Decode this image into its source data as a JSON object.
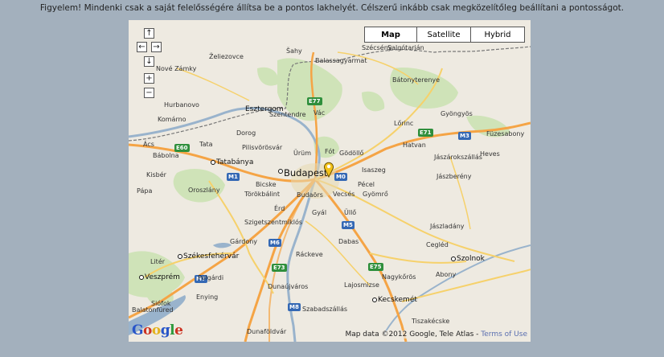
{
  "notice": "Figyelem! Mindenki csak a saját felelősségére állítsa be a pontos lakhelyét. Célszerű inkább csak megközelítőleg beállítani a pontosságot.",
  "map_types": [
    {
      "label": "Map",
      "active": true
    },
    {
      "label": "Satellite",
      "active": false
    },
    {
      "label": "Hybrid",
      "active": false
    }
  ],
  "nav": {
    "pan_up": "↑",
    "pan_left": "←",
    "pan_right": "→",
    "pan_down": "↓",
    "zoom_in": "+",
    "zoom_out": "−"
  },
  "places": {
    "capital": "Budapest",
    "cities": [
      "Tatabánya",
      "Székesfehérvár",
      "Veszprém",
      "Kecskemét",
      "Szolnok",
      "Esztergom"
    ],
    "towns": [
      "Šahy",
      "Balassagyarmat",
      "Szécsény",
      "Salgótarján",
      "Želiezovce",
      "Nové Zámky",
      "Bátonyterenye",
      "Hurbanovo",
      "Komárno",
      "Vác",
      "Dorog",
      "Szentendre",
      "Pilisvörösvár",
      "Ürüm",
      "Fót",
      "Gödöllő",
      "Gyöngyös",
      "Lőrinc",
      "Hatvan",
      "Füzesabony",
      "Heves",
      "Jászárokszállás",
      "Jászberény",
      "Isaszeg",
      "Kisbér",
      "Bicske",
      "Oroszlány",
      "Törökbálint",
      "Budaörs",
      "Vecsés",
      "Gyömrő",
      "Pécel",
      "Érd",
      "Gyál",
      "Üllő",
      "Szigetszentmiklós",
      "Gárdony",
      "Dabas",
      "Cegléd",
      "Jászladány",
      "Abony",
      "Nagykőrös",
      "Ráckeve",
      "Lajosmizse",
      "Dunaújváros",
      "Szabadszállás",
      "Litér",
      "Siófok",
      "Enying",
      "Balatonfüred",
      "Polgárdi",
      "Dunaföldvár",
      "Tiszakécske",
      "Ács",
      "Bábolna",
      "Tata",
      "Pápa"
    ],
    "roads": [
      "E77",
      "E71",
      "M3",
      "E60",
      "M1",
      "M0",
      "M6",
      "M5",
      "E73",
      "E75",
      "M7",
      "M8"
    ]
  },
  "attribution": {
    "text": "Map data ©2012 Google, Tele Atlas - ",
    "link": "Terms of Use"
  },
  "logo": [
    "G",
    "o",
    "o",
    "g",
    "l",
    "e"
  ],
  "colors": {
    "page_bg": "#a3b0bd",
    "map_land": "#eeeae1",
    "forest": "#cfe3b8",
    "water": "#99b3cc",
    "motorway": "#f5a445",
    "major_road": "#f6d16b"
  }
}
